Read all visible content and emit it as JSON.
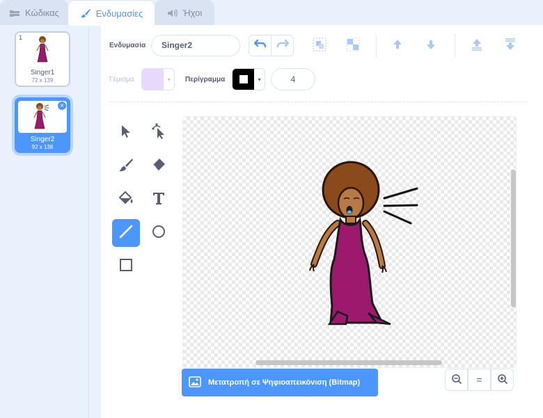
{
  "tabs": [
    {
      "label": "Κώδικας",
      "icon": "code-icon"
    },
    {
      "label": "Ενδυμασίες",
      "icon": "brush-icon"
    },
    {
      "label": "Ήχοι",
      "icon": "speaker-icon"
    }
  ],
  "costumes": [
    {
      "number": "1",
      "name": "Singer1",
      "size": "72 x 139"
    },
    {
      "number": "2",
      "name": "Singer2",
      "size": "92 x 138",
      "delete_label": "×"
    }
  ],
  "editor": {
    "costume_label": "Ενδυμασία",
    "costume_name": "Singer2",
    "fill_label": "Γέμισμα",
    "outline_label": "Περίγραμμα",
    "outline_width": "4",
    "fill_color": "#e6d9fb",
    "outline_color": "#000000",
    "convert_button": "Μετατροπή σε Ψηφιοαπεικόνιση (Bitmap)",
    "zoom_reset_label": "="
  },
  "colors": {
    "accent": "#4c97ff",
    "dress": "#9c1a6e",
    "skin": "#b87a45",
    "hair": "#8a4a1c"
  }
}
